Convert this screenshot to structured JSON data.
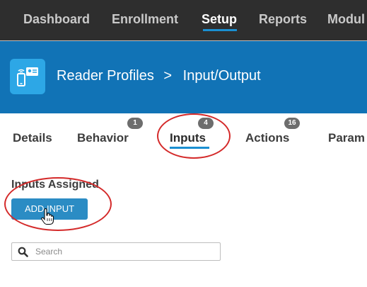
{
  "topnav": {
    "items": [
      "Dashboard",
      "Enrollment",
      "Setup",
      "Reports",
      "Modul"
    ],
    "active": "Setup"
  },
  "header": {
    "breadcrumb_parent": "Reader Profiles",
    "separator": ">",
    "breadcrumb_current": "Input/Output",
    "icon": "reader-profile-icon"
  },
  "tabs": [
    {
      "label": "Details",
      "badge": null
    },
    {
      "label": "Behavior",
      "badge": "1"
    },
    {
      "label": "Inputs",
      "badge": "4"
    },
    {
      "label": "Actions",
      "badge": "16"
    },
    {
      "label": "Param",
      "badge": null
    }
  ],
  "active_tab": "Inputs",
  "section": {
    "title": "Inputs Assigned",
    "add_button": "ADD INPUT"
  },
  "search": {
    "placeholder": "Search",
    "value": ""
  },
  "colors": {
    "topnav_bg": "#2e2e2e",
    "header_bg": "#1173b6",
    "accent": "#1a8fd1",
    "button_bg": "#2b8cc4",
    "annotation": "#d42a2a"
  }
}
